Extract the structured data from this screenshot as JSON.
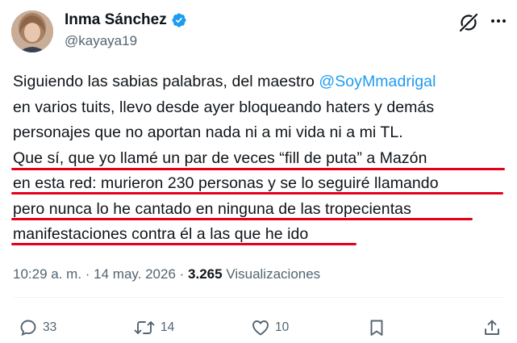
{
  "author": {
    "name": "Inma Sánchez",
    "handle": "@kayaya19"
  },
  "tweet": {
    "lines": [
      {
        "text": "Siguiendo las sabias palabras, del maestro ",
        "mention": "@SoyMmadrigal"
      },
      {
        "text": "en varios tuits, llevo desde ayer bloqueando haters y demás"
      },
      {
        "text": "personajes que no aportan nada ni a mi vida ni a mi TL."
      },
      {
        "text": "Que sí, que yo llamé un par de veces “fill de puta” a Mazón"
      },
      {
        "text": "en esta red: murieron 230 personas  y se lo seguiré llamando"
      },
      {
        "text": "pero nunca lo he cantado en ninguna de las tropecientas"
      },
      {
        "text": "manifestaciones contra él a las que he ido"
      }
    ],
    "underline_color": "#e3001b"
  },
  "meta": {
    "time": "10:29 a. m.",
    "sep1": " · ",
    "date": "14 may. 2026",
    "sep2": " · ",
    "views_count": "3.265",
    "views_label": " Visualizaciones"
  },
  "actions": {
    "replies": "33",
    "reposts": "14",
    "likes": "10"
  },
  "colors": {
    "text": "#0f1419",
    "secondary": "#536471",
    "link": "#1d9bf0",
    "verified": "#1d9bf0"
  },
  "icons": [
    "verified-badge-icon",
    "grok-icon",
    "more-icon",
    "reply-icon",
    "repost-icon",
    "like-icon",
    "bookmark-icon",
    "share-icon"
  ]
}
